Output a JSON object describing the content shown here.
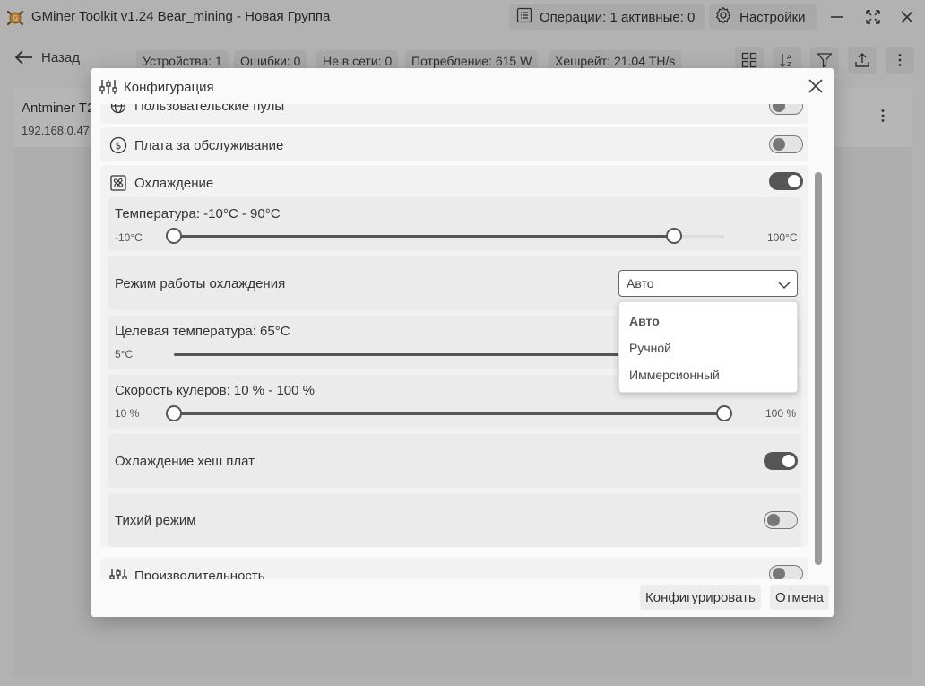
{
  "app": {
    "title": "GMiner Toolkit v1.24 Bear_mining - Новая Группа",
    "operations_label": "Операции: 1 активные: 0",
    "settings_label": "Настройки"
  },
  "toolbar": {
    "back_label": "Назад",
    "stats": {
      "devices": "Устройства: 1",
      "errors": "Ошибки: 0",
      "offline": "Не в сети: 0",
      "power": "Потребление: 615 W",
      "hashrate": "Хешрейт: 21.04 TH/s"
    }
  },
  "device": {
    "name": "Antminer T2",
    "ip": "192.168.0.47 ("
  },
  "dialog": {
    "title": "Конфигурация",
    "sections": {
      "pools": {
        "label": "Пользовательские пулы",
        "enabled": false
      },
      "service_fee": {
        "label": "Плата за обслуживание",
        "enabled": false
      },
      "cooling": {
        "label": "Охлаждение",
        "enabled": true
      },
      "performance": {
        "label": "Производительность",
        "enabled": false
      }
    },
    "cooling": {
      "temperature": {
        "title": "Температура: -10°C - 90°C",
        "min_label": "-10°C",
        "max_label": "100°C",
        "range": [
          -10,
          100
        ],
        "low": -10,
        "high": 90
      },
      "mode": {
        "label": "Режим работы охлаждения",
        "selected": "Авто",
        "options": [
          "Авто",
          "Ручной",
          "Иммерсионный"
        ]
      },
      "target_temp": {
        "title": "Целевая температура: 65°C",
        "min_label": "5°C",
        "value": 65
      },
      "fan_speed": {
        "title": "Скорость кулеров: 10 % - 100 %",
        "min_label": "10 %",
        "max_label": "100 %",
        "range": [
          10,
          100
        ],
        "low": 10,
        "high": 100
      },
      "hashboard_cooling": {
        "label": "Охлаждение хеш плат",
        "enabled": true
      },
      "quiet_mode": {
        "label": "Тихий режим",
        "enabled": false
      }
    },
    "buttons": {
      "configure": "Конфигурировать",
      "cancel": "Отмена"
    }
  }
}
